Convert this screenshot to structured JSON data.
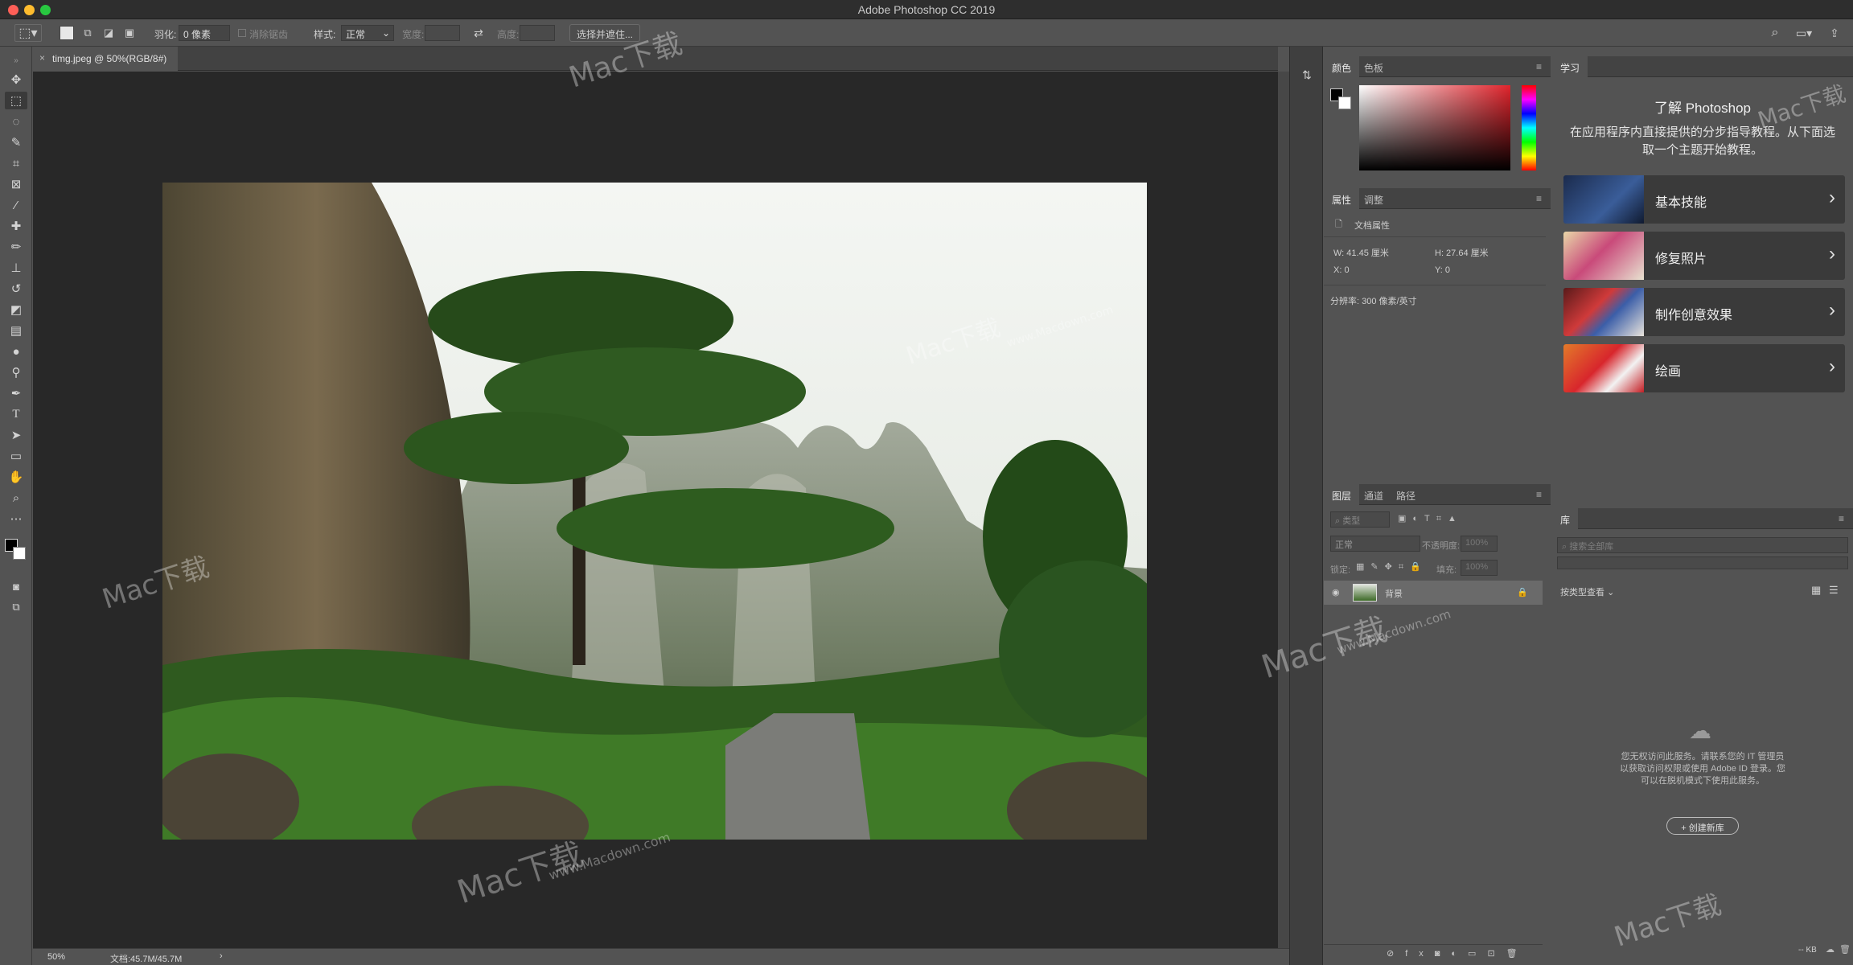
{
  "app": {
    "title": "Adobe Photoshop CC 2019"
  },
  "options_bar": {
    "feather_label": "羽化:",
    "feather_value": "0 像素",
    "anti_alias_label": "消除锯齿",
    "style_label": "样式:",
    "style_value": "正常",
    "width_label": "宽度:",
    "height_label": "高度:",
    "select_mask_button": "选择并遮住..."
  },
  "document": {
    "tab_label": "timg.jpeg @ 50%(RGB/8#)",
    "zoom": "50%",
    "doc_info": "文档:45.7M/45.7M"
  },
  "color_panel": {
    "tabs": [
      "颜色",
      "色板"
    ],
    "accent": "#e0242c"
  },
  "properties_panel": {
    "tabs": [
      "属性",
      "调整"
    ],
    "section": "文档属性",
    "w": "W: 41.45 厘米",
    "h": "H: 27.64 厘米",
    "x": "X: 0",
    "y": "Y: 0",
    "resolution": "分辨率: 300 像素/英寸"
  },
  "layers_panel": {
    "tabs": [
      "图层",
      "通道",
      "路径"
    ],
    "filter_placeholder": "类型",
    "blend_mode": "正常",
    "opacity_label": "不透明度:",
    "opacity_value": "100%",
    "lock_label": "锁定:",
    "fill_label": "填充:",
    "fill_value": "100%",
    "layer_name": "背景"
  },
  "learn_panel": {
    "tab": "学习",
    "heading": "了解 Photoshop",
    "description": "在应用程序内直接提供的分步指导教程。从下面选取一个主题开始教程。",
    "cards": [
      {
        "label": "基本技能"
      },
      {
        "label": "修复照片"
      },
      {
        "label": "制作创意效果"
      },
      {
        "label": "绘画"
      }
    ]
  },
  "library_panel": {
    "tab": "库",
    "search_placeholder": "搜索全部库",
    "view_by": "按类型查看",
    "message": "您无权访问此服务。请联系您的 IT 管理员以获取访问权限或使用 Adobe ID 登录。您可以在脱机模式下使用此服务。",
    "create_button": "+ 创建新库",
    "size": "-- KB"
  },
  "watermark": {
    "brand": "Mac下载",
    "url": "www.Macdown.com"
  }
}
